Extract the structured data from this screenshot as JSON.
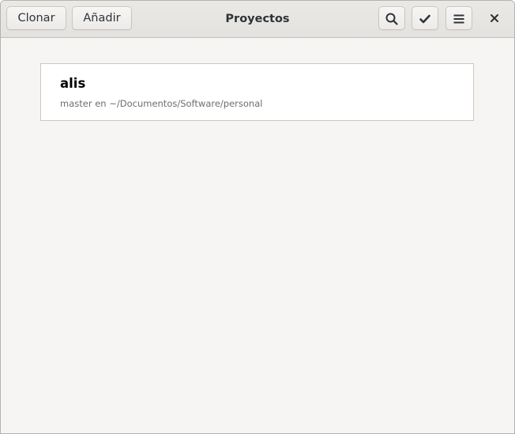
{
  "window": {
    "title": "Proyectos"
  },
  "header": {
    "clone_label": "Clonar",
    "add_label": "Añadir",
    "icons": {
      "search": "search-icon",
      "select": "check-icon",
      "menu": "hamburger-menu-icon",
      "close": "close-icon"
    }
  },
  "projects": [
    {
      "name": "alis",
      "details": "master en ~/Documentos/Software/personal"
    }
  ],
  "colors": {
    "window_bg": "#f6f5f4",
    "header_bg": "#e8e6e3",
    "text": "#2e3436",
    "secondary_text": "#6e6e6e",
    "list_bg": "#ffffff",
    "border": "#cdc7c2"
  }
}
